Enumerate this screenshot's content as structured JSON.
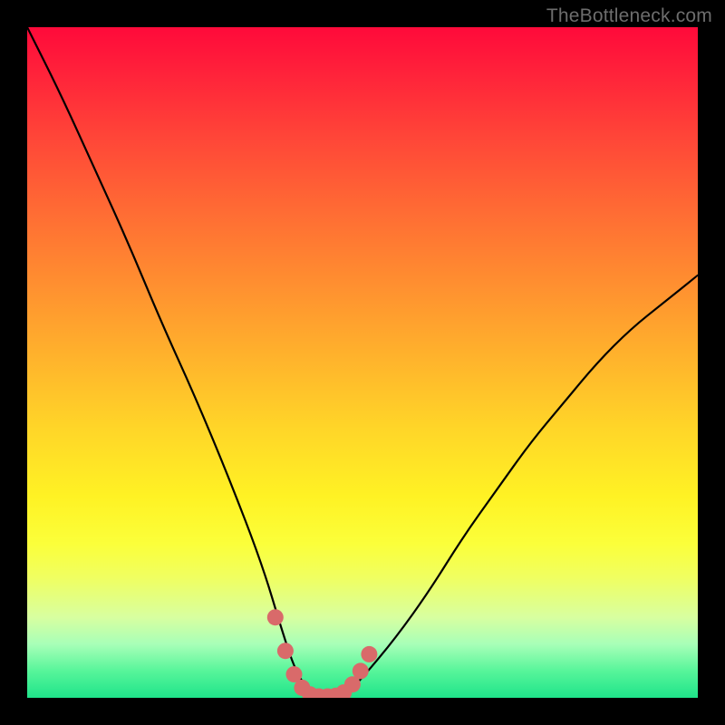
{
  "watermark": "TheBottleneck.com",
  "chart_data": {
    "type": "line",
    "title": "",
    "xlabel": "",
    "ylabel": "",
    "xlim": [
      0,
      100
    ],
    "ylim": [
      0,
      100
    ],
    "series": [
      {
        "name": "bottleneck-curve",
        "x": [
          0,
          5,
          10,
          15,
          20,
          25,
          30,
          35,
          38,
          40,
          42,
          44,
          46,
          48,
          50,
          55,
          60,
          65,
          70,
          75,
          80,
          85,
          90,
          95,
          100
        ],
        "values": [
          100,
          90,
          79,
          68,
          56,
          45,
          33,
          20,
          10,
          4,
          1,
          0,
          0,
          1,
          3,
          9,
          16,
          24,
          31,
          38,
          44,
          50,
          55,
          59,
          63
        ]
      }
    ],
    "markers": {
      "name": "trough-dots",
      "color": "#d96a6a",
      "points": [
        {
          "x": 37.0,
          "y": 12.0
        },
        {
          "x": 38.5,
          "y": 7.0
        },
        {
          "x": 39.8,
          "y": 3.5
        },
        {
          "x": 41.0,
          "y": 1.5
        },
        {
          "x": 42.2,
          "y": 0.5
        },
        {
          "x": 43.5,
          "y": 0.2
        },
        {
          "x": 44.8,
          "y": 0.2
        },
        {
          "x": 46.0,
          "y": 0.3
        },
        {
          "x": 47.2,
          "y": 0.8
        },
        {
          "x": 48.5,
          "y": 2.0
        },
        {
          "x": 49.7,
          "y": 4.0
        },
        {
          "x": 51.0,
          "y": 6.5
        }
      ]
    }
  }
}
